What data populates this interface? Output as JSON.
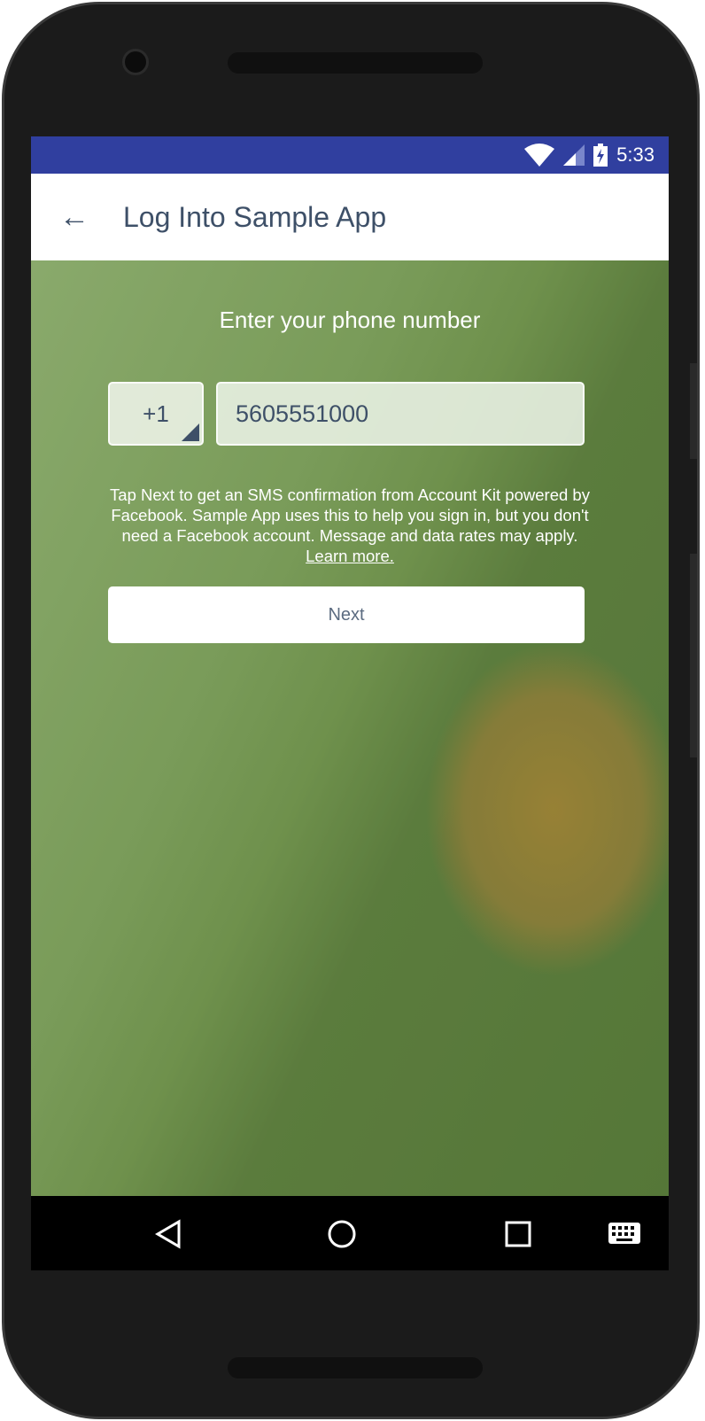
{
  "status_bar": {
    "time": "5:33",
    "icons": [
      "wifi-icon",
      "cell-signal-icon",
      "battery-charging-icon"
    ],
    "color": "#303f9f"
  },
  "app_bar": {
    "title": "Log Into Sample App",
    "back_icon": "arrow-left-icon"
  },
  "main": {
    "heading": "Enter your phone number",
    "country_code": "+1",
    "phone_number": "5605551000",
    "disclaimer": "Tap Next to get an SMS confirmation from Account Kit powered by Facebook. Sample App uses this to help you sign in, but you don't need a Facebook account. Message and data rates may apply.",
    "learn_more": "Learn more.",
    "next_label": "Next"
  },
  "nav_bar": {
    "icons": [
      "back-triangle-icon",
      "home-circle-icon",
      "recents-square-icon",
      "keyboard-icon"
    ]
  }
}
